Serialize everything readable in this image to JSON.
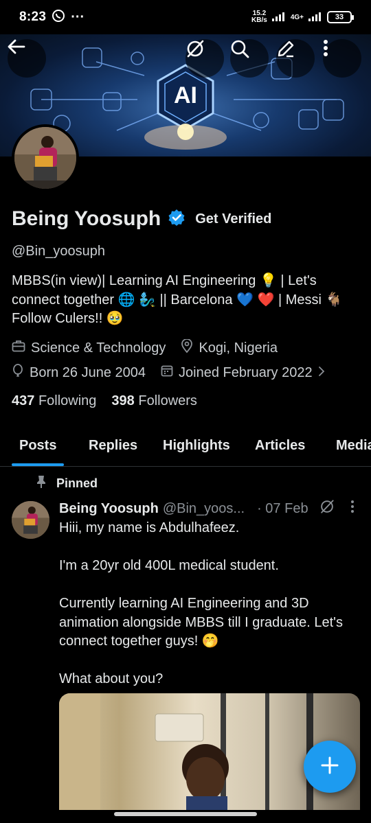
{
  "status_bar": {
    "time": "8:23",
    "speed_value": "15.2",
    "speed_unit": "KB/s",
    "network": "4G+",
    "battery": "33"
  },
  "profile": {
    "display_name": "Being Yoosuph",
    "get_verified": "Get Verified",
    "handle": "@Bin_yoosuph",
    "bio": "MBBS(in view)| Learning AI Engineering 💡 | Let's connect together 🌐 🧞‍♂️ || Barcelona 💙 ❤️ | Messi 🐐 Follow Culers!! 🥹",
    "category": "Science & Technology",
    "location": "Kogi, Nigeria",
    "birth": "Born 26 June 2004",
    "joined": "Joined February 2022",
    "following_count": "437",
    "following_label": "Following",
    "followers_count": "398",
    "followers_label": "Followers"
  },
  "banner": {
    "ai_label": "AI"
  },
  "tabs": [
    {
      "label": "Posts",
      "active": true
    },
    {
      "label": "Replies"
    },
    {
      "label": "Highlights"
    },
    {
      "label": "Articles"
    },
    {
      "label": "Media"
    }
  ],
  "post": {
    "pinned_label": "Pinned",
    "author_name": "Being Yoosuph",
    "author_handle": "@Bin_yoos...",
    "date": "· 07 Feb",
    "text": "Hiii, my name is Abdulhafeez.\n\nI'm a 20yr old 400L medical student.\n\nCurrently learning AI Engineering and 3D animation alongside MBBS till I graduate. Let's connect together guys! 🤭\n\nWhat about you?"
  },
  "colors": {
    "accent": "#1d9bf0",
    "background": "#000000",
    "secondary_text": "#8b9096"
  },
  "icons": [
    "back-arrow-icon",
    "grok-icon",
    "search-icon",
    "edit-icon",
    "more-vertical-icon",
    "verified-badge-icon",
    "briefcase-icon",
    "location-pin-icon",
    "balloon-icon",
    "calendar-icon",
    "chevron-right-icon",
    "pin-icon",
    "plus-icon"
  ]
}
